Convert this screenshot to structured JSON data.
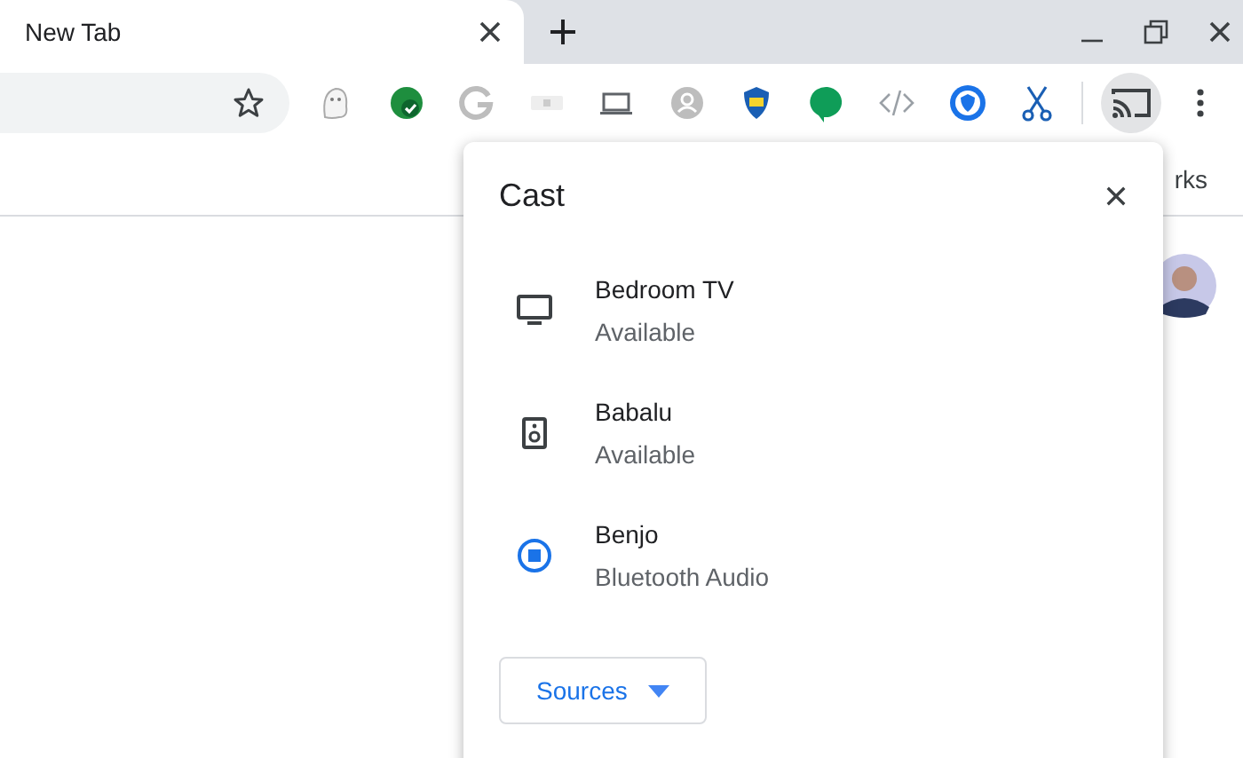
{
  "tab": {
    "title": "New Tab",
    "selected": true
  },
  "toolbar": {
    "cast_button": {
      "selected": true
    }
  },
  "bookmarks_bar": {
    "partial_text": "rks"
  },
  "cast_dialog": {
    "title": "Cast",
    "devices": [
      {
        "kind": "tv",
        "name": "Bedroom TV",
        "status": "Available"
      },
      {
        "kind": "speaker",
        "name": "Babalu",
        "status": "Available"
      },
      {
        "kind": "bluetooth",
        "name": "Benjo",
        "status": "Bluetooth Audio"
      }
    ],
    "sources_button": "Sources"
  }
}
